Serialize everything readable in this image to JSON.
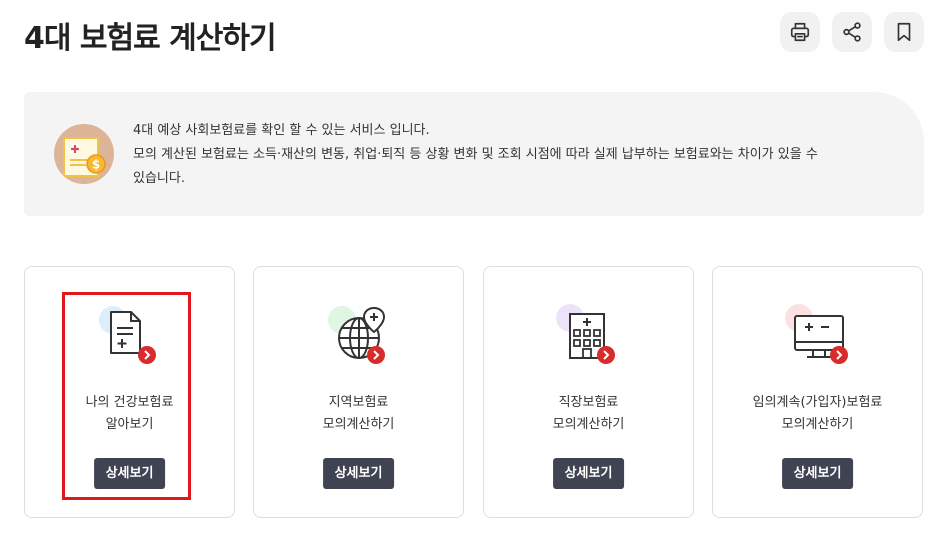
{
  "page": {
    "title": "4대 보험료 계산하기"
  },
  "toolbar": {
    "print_icon": "printer-icon",
    "share_icon": "share-icon",
    "bookmark_icon": "bookmark-icon"
  },
  "notice": {
    "icon": "document-coin-icon",
    "lines": [
      "4대 예상 사회보험료를 확인 할 수 있는 서비스 입니다.",
      "모의 계산된 보험료는 소득·재산의 변동, 취업·퇴직 등 상황 변화 및 조회 시점에 따라 실제 납부하는 보험료와는 차이가 있을 수",
      "있습니다."
    ]
  },
  "cards": [
    {
      "icon": "document-plus-icon",
      "accent": "#dbeefb",
      "label_line1": "나의 건강보험료",
      "label_line2": "알아보기",
      "button": "상세보기"
    },
    {
      "icon": "globe-location-icon",
      "accent": "#dff6e2",
      "label_line1": "지역보험료",
      "label_line2": "모의계산하기",
      "button": "상세보기"
    },
    {
      "icon": "hospital-building-icon",
      "accent": "#ece3f8",
      "label_line1": "직장보험료",
      "label_line2": "모의계산하기",
      "button": "상세보기"
    },
    {
      "icon": "monitor-calculator-icon",
      "accent": "#fce1e3",
      "label_line1": "임의계속(가입자)보험료",
      "label_line2": "모의계산하기",
      "button": "상세보기"
    }
  ],
  "colors": {
    "button_bg": "#3f4352",
    "arrow_badge": "#d82b2b",
    "highlight": "#e0181b"
  }
}
